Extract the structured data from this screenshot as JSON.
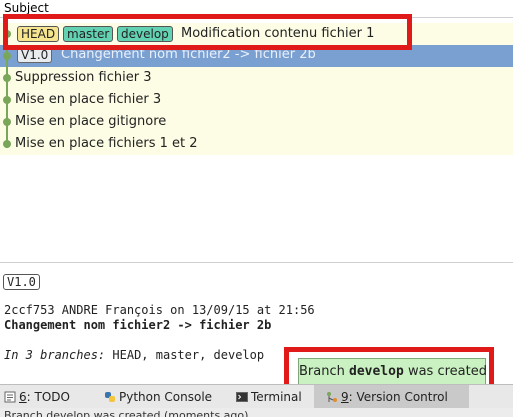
{
  "log": {
    "column_subject": "Subject",
    "commits": [
      {
        "subject": "Modification contenu fichier 1",
        "refs": [
          "HEAD",
          "master",
          "develop"
        ]
      },
      {
        "subject": "Changement nom fichier2 -> fichier 2b",
        "refs": [
          "V1.0"
        ],
        "selected": true
      },
      {
        "subject": "Suppression fichier 3",
        "refs": []
      },
      {
        "subject": "Mise en place fichier 3",
        "refs": []
      },
      {
        "subject": "Mise en place gitignore",
        "refs": []
      },
      {
        "subject": "Mise en place fichiers 1 et 2",
        "refs": []
      }
    ]
  },
  "details": {
    "tag": "V1.0",
    "meta": "2ccf753 ANDRE François on 13/09/15 at 21:56",
    "subject": "Changement nom fichier2 -> fichier 2b",
    "branches_lead": "In 3 branches:",
    "branches_list": "HEAD, master, develop"
  },
  "notification": {
    "prefix": "Branch",
    "branch": "develop",
    "suffix": "was created"
  },
  "toolwindows": {
    "todo": {
      "mnemonic": "6",
      "label": ": TODO"
    },
    "python_console": {
      "label": "Python Console"
    },
    "terminal": {
      "label": "Terminal"
    },
    "version_control": {
      "mnemonic": "9",
      "label": ": Version Control"
    }
  },
  "status": {
    "text": "Branch develop was created (moments ago)"
  },
  "colors": {
    "highlight_box": "#e01919",
    "row_background": "#fdfde5",
    "selected_row": "#7aa0d2",
    "graph": "#7aa65a",
    "head_badge": "#f6e58e",
    "branch_badge": "#62d2b2",
    "notification": "#caf1c2"
  }
}
